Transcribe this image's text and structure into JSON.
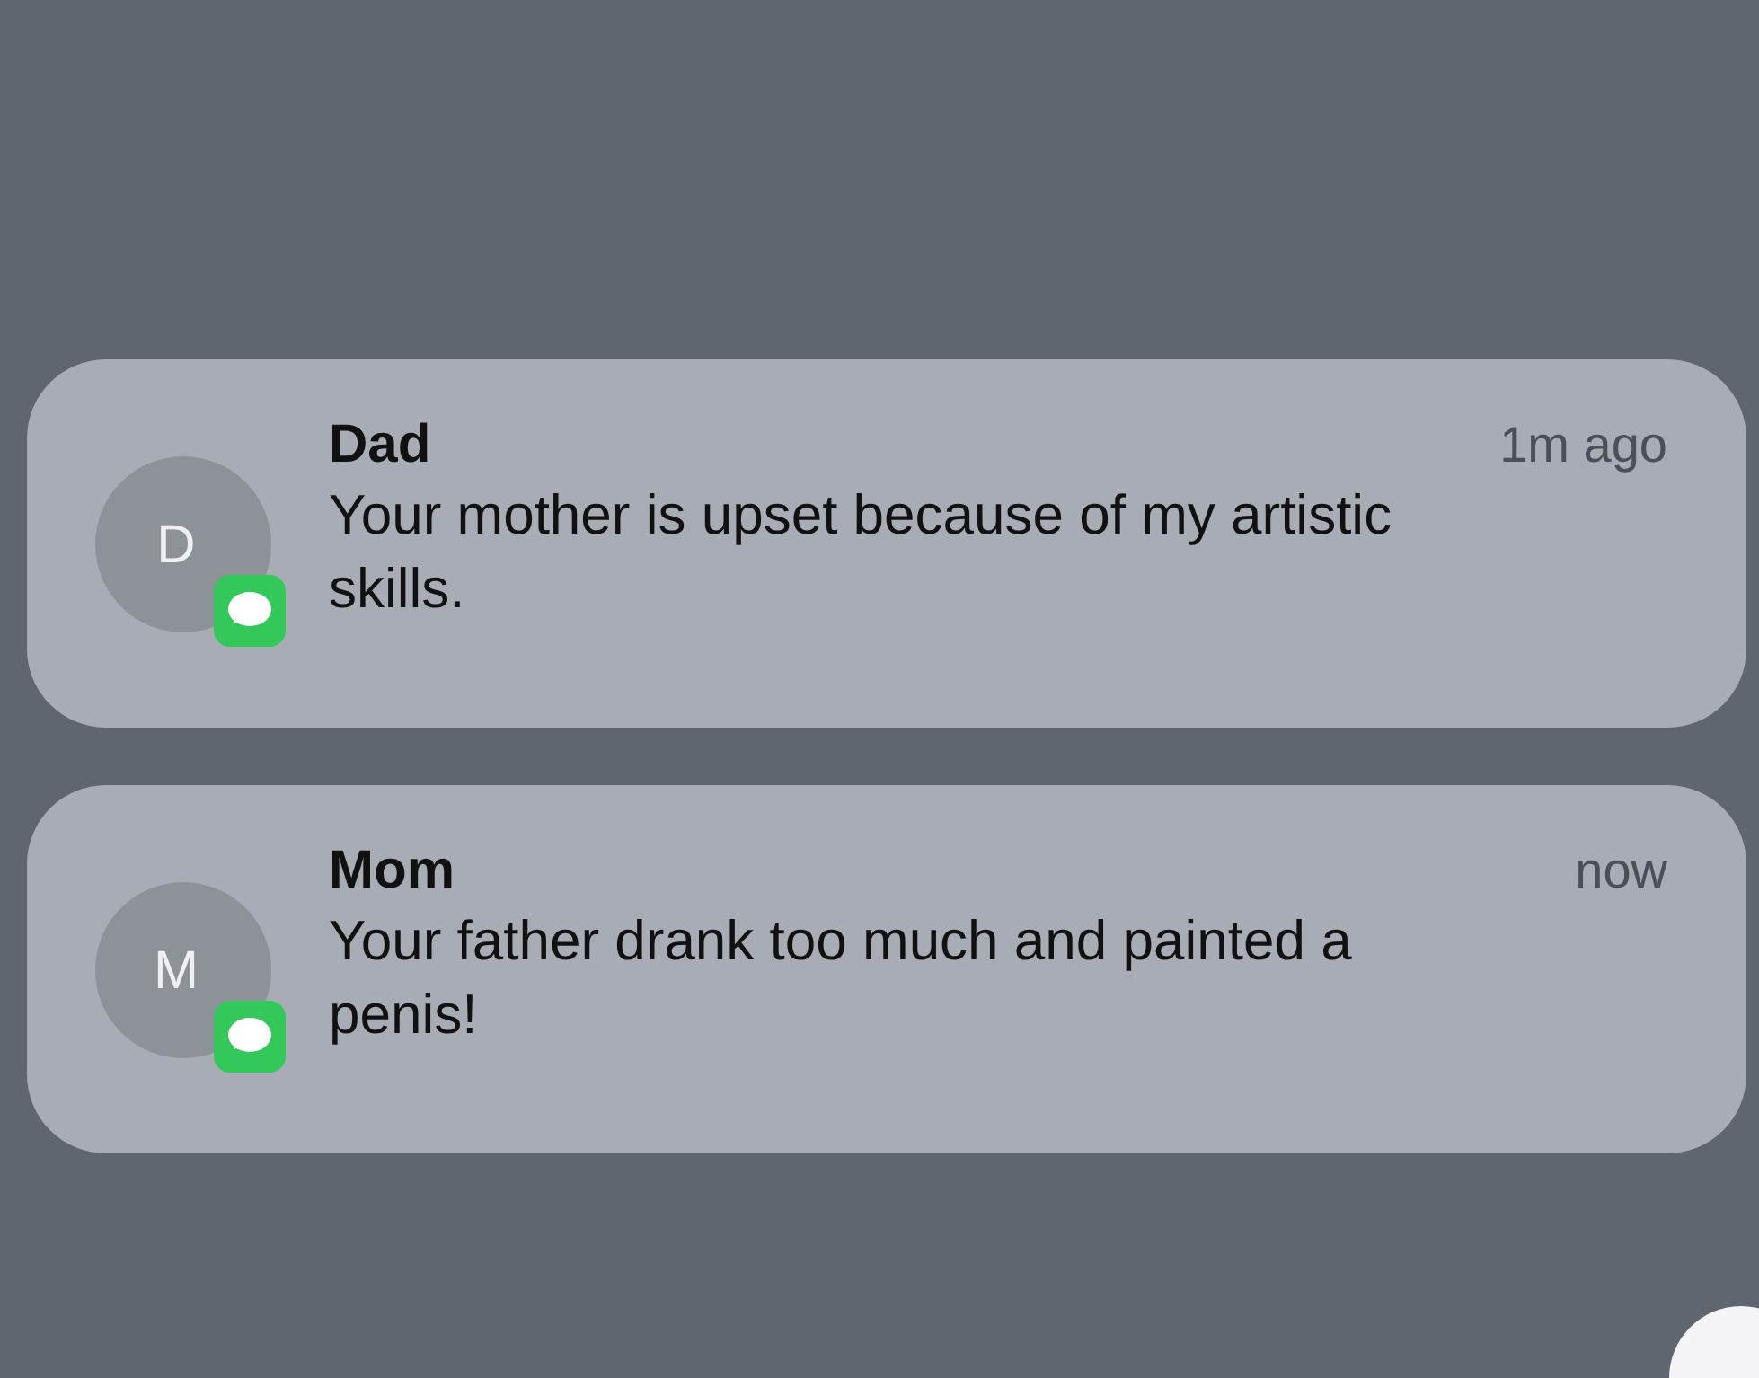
{
  "notifications": [
    {
      "initial": "D",
      "sender": "Dad",
      "time": "1m ago",
      "message": "Your mother is upset because of my artistic skills."
    },
    {
      "initial": "M",
      "sender": "Mom",
      "time": "now",
      "message": "Your father drank too much and painted a penis!"
    }
  ]
}
